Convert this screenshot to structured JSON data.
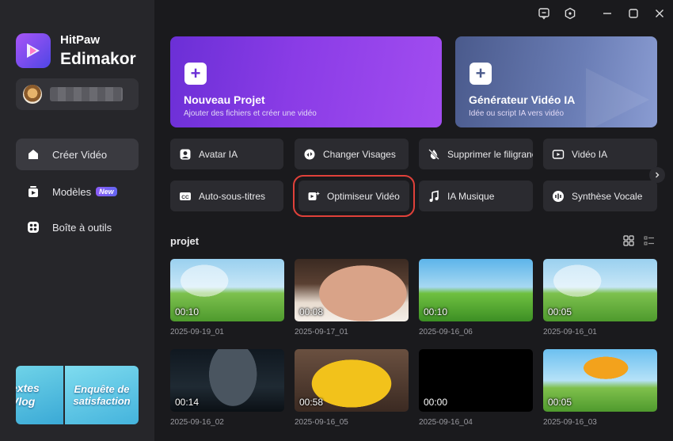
{
  "app": {
    "brand_top": "HitPaw",
    "brand_main": "Edimakor"
  },
  "nav": {
    "create_video": "Créer Vidéo",
    "models": "Modèles",
    "models_badge": "New",
    "toolbox": "Boîte à outils"
  },
  "promo": {
    "left": "extes\nVlog",
    "right": "Enquête de satisfaction"
  },
  "hero": {
    "new_project": {
      "title": "Nouveau Projet",
      "subtitle": "Ajouter des fichiers et créer une vidéo"
    },
    "ai_generator": {
      "title": "Générateur Vidéo IA",
      "subtitle": "Idée ou script IA vers vidéo"
    }
  },
  "tools": {
    "avatar_ia": "Avatar IA",
    "face_swap": "Changer Visages",
    "remove_watermark": "Supprimer le filigrane",
    "video_ia": "Vidéo IA",
    "auto_subtitles": "Auto-sous-titres",
    "video_optimizer": "Optimiseur Vidéo",
    "ia_music": "IA Musique",
    "tts": "Synthèse Vocale"
  },
  "projects": {
    "title": "projet",
    "items": [
      {
        "duration": "00:10",
        "name": "2025-09-19_01",
        "scene": "anime"
      },
      {
        "duration": "00:08",
        "name": "2025-09-17_01",
        "scene": "baby"
      },
      {
        "duration": "00:10",
        "name": "2025-09-16_06",
        "scene": "field"
      },
      {
        "duration": "00:05",
        "name": "2025-09-16_01",
        "scene": "anime"
      },
      {
        "duration": "00:14",
        "name": "2025-09-16_02",
        "scene": "dark"
      },
      {
        "duration": "00:58",
        "name": "2025-09-16_05",
        "scene": "food"
      },
      {
        "duration": "00:00",
        "name": "2025-09-16_04",
        "scene": "black"
      },
      {
        "duration": "00:05",
        "name": "2025-09-16_03",
        "scene": "umbrella"
      }
    ]
  },
  "colors": {
    "accent": "#8b5cf6",
    "highlight": "#e0413a",
    "background": "#1a1a1d",
    "sidebar": "#26262a"
  }
}
